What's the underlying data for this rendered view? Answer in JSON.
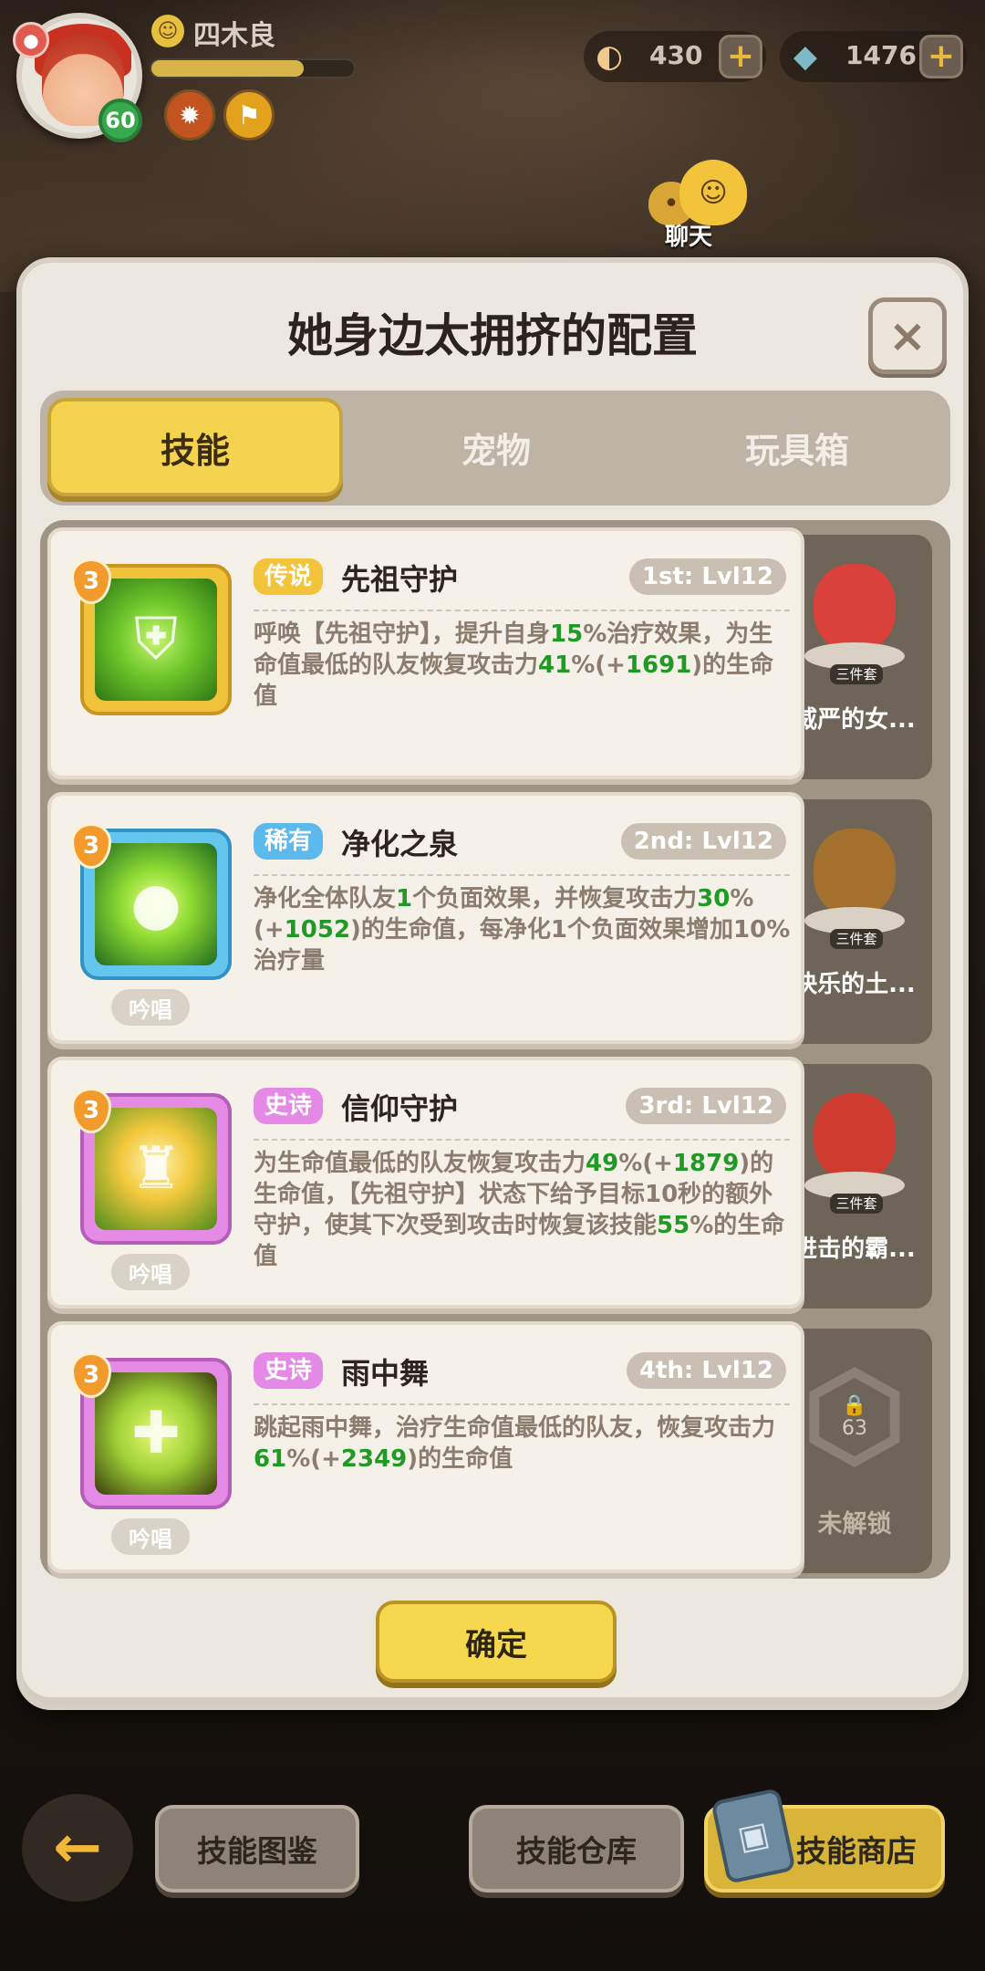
{
  "hud": {
    "player_name": "四木良",
    "level": "60",
    "xp_fraction": 0.75,
    "currencies": [
      {
        "icon": "shell-icon",
        "value": "430"
      },
      {
        "icon": "gem-icon",
        "value": "1476"
      }
    ],
    "plus_label": "+",
    "chat_label": "聊天"
  },
  "panel": {
    "title": "她身边太拥挤的配置",
    "close_label": "×",
    "tabs": [
      {
        "label": "技能",
        "active": true
      },
      {
        "label": "宠物",
        "active": false
      },
      {
        "label": "玩具箱",
        "active": false
      }
    ],
    "confirm_label": "确定"
  },
  "skills": [
    {
      "rank": "3",
      "rarity": "传说",
      "name": "先祖守护",
      "level": "1st: Lvl12",
      "chant": "",
      "desc_parts": [
        "呼唤【先祖守护】，提升自身",
        "15",
        "%治疗效果，为生命值最低的队友恢复攻击力",
        "41",
        "%(+",
        "1691",
        ")的生命值"
      ]
    },
    {
      "rank": "3",
      "rarity": "稀有",
      "name": "净化之泉",
      "level": "2nd: Lvl12",
      "chant": "吟唱",
      "desc_parts": [
        "净化全体队友",
        "1",
        "个负面效果，并恢复攻击力",
        "30",
        "%(+",
        "1052",
        ")的生命值，每净化1个负面效果增加10%治疗量"
      ]
    },
    {
      "rank": "3",
      "rarity": "史诗",
      "name": "信仰守护",
      "level": "3rd: Lvl12",
      "chant": "吟唱",
      "desc_parts": [
        "为生命值最低的队友恢复攻击力",
        "49",
        "%(+",
        "1879",
        ")的生命值，【先祖守护】状态下给予目标10秒的额外守护，使其下次受到攻击时恢复该技能",
        "55",
        "%的生命值"
      ]
    },
    {
      "rank": "3",
      "rarity": "史诗",
      "name": "雨中舞",
      "level": "4th: Lvl12",
      "chant": "吟唱",
      "desc_parts": [
        "跳起雨中舞，治疗生命值最低的队友，恢复攻击力",
        "61",
        "%(+",
        "2349",
        ")的生命值"
      ]
    }
  ],
  "pets": [
    {
      "name": "威严的女...",
      "tag": "三件套",
      "color": "#d9413a"
    },
    {
      "name": "快乐的土...",
      "tag": "三件套",
      "color": "#a3702d"
    },
    {
      "name": "进击的霸...",
      "tag": "三件套",
      "color": "#cf3b2f"
    },
    {
      "locked": true,
      "unlock_level": "63",
      "name": "未解锁"
    }
  ],
  "bottom_bar": {
    "back_label": "←",
    "buttons": [
      "技能图鉴",
      "技能仓库",
      "技能商店"
    ]
  }
}
